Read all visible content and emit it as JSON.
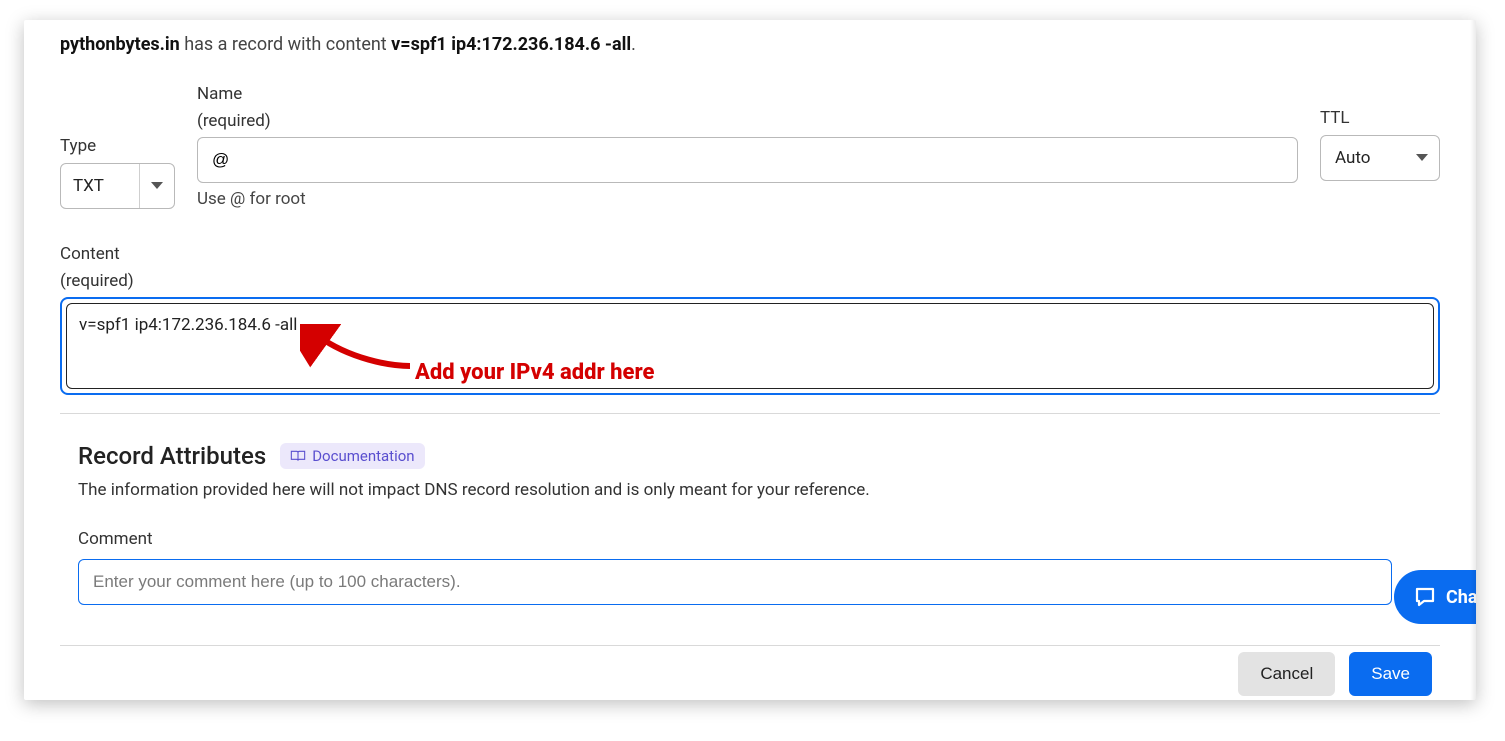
{
  "heading": {
    "domain": "pythonbytes.in",
    "mid_text": " has a record with content ",
    "bold_value": "v=spf1 ip4:172.236.184.6 -all",
    "trailing": "."
  },
  "type": {
    "label": "Type",
    "value": "TXT"
  },
  "name": {
    "label": "Name",
    "required": "(required)",
    "value": "@",
    "hint": "Use @ for root"
  },
  "ttl": {
    "label": "TTL",
    "value": "Auto"
  },
  "content": {
    "label": "Content",
    "required": "(required)",
    "value": "v=spf1 ip4:172.236.184.6 -all"
  },
  "annotation": {
    "text": "Add your IPv4 addr here"
  },
  "attributes": {
    "title": "Record Attributes",
    "doc_label": "Documentation",
    "description": "The information provided here will not impact DNS record resolution and is only meant for your reference."
  },
  "comment": {
    "label": "Comment",
    "placeholder": "Enter your comment here (up to 100 characters)."
  },
  "buttons": {
    "cancel": "Cancel",
    "save": "Save"
  },
  "chat": {
    "label": "Chat"
  }
}
